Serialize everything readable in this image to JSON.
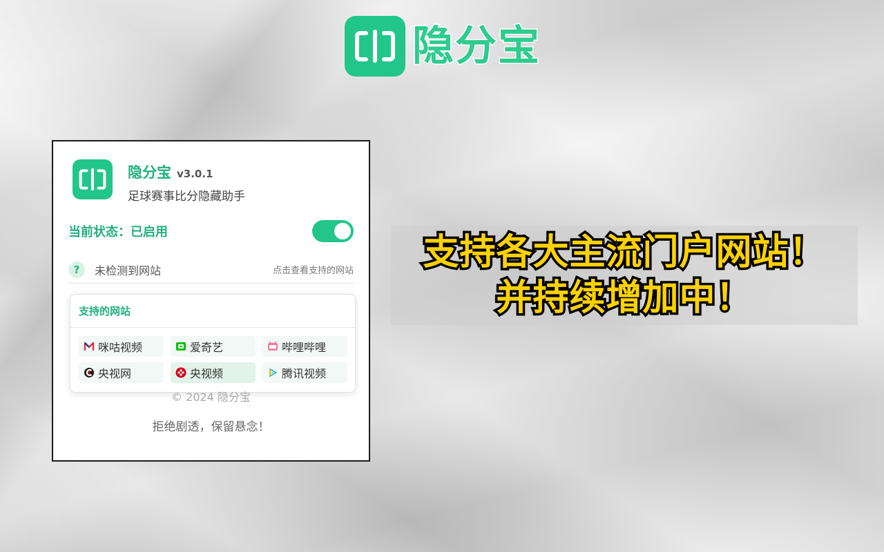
{
  "brand": {
    "name": "隐分宝",
    "logo_icon": "split-bracket-icon",
    "accent_color": "#22c68a"
  },
  "popup": {
    "title": "隐分宝",
    "version": "v3.0.1",
    "subtitle": "足球赛事比分隐藏助手",
    "status_label": "当前状态：已启用",
    "toggle_on": true,
    "detect_text": "未检测到网站",
    "detect_link": "点击查看支持的网站",
    "sites_title": "支持的网站",
    "sites": [
      {
        "label": "咪咕视频",
        "icon": "migu-icon",
        "color": "#e0333c"
      },
      {
        "label": "爱奇艺",
        "icon": "iqiyi-icon",
        "color": "#00be06"
      },
      {
        "label": "哔哩哔哩",
        "icon": "bilibili-icon",
        "color": "#fb7299"
      },
      {
        "label": "央视网",
        "icon": "cntv-icon",
        "color": "#d71920"
      },
      {
        "label": "央视频",
        "icon": "yangshipin-icon",
        "color": "#d0021b"
      },
      {
        "label": "腾讯视频",
        "icon": "tencent-video-icon",
        "color": "#1fb4e8"
      }
    ],
    "copyright": "© 2024 隐分宝",
    "slogan": "拒绝剧透，保留悬念！"
  },
  "caption": {
    "line1": "支持各大主流门户网站！",
    "line2": "并持续增加中！"
  }
}
